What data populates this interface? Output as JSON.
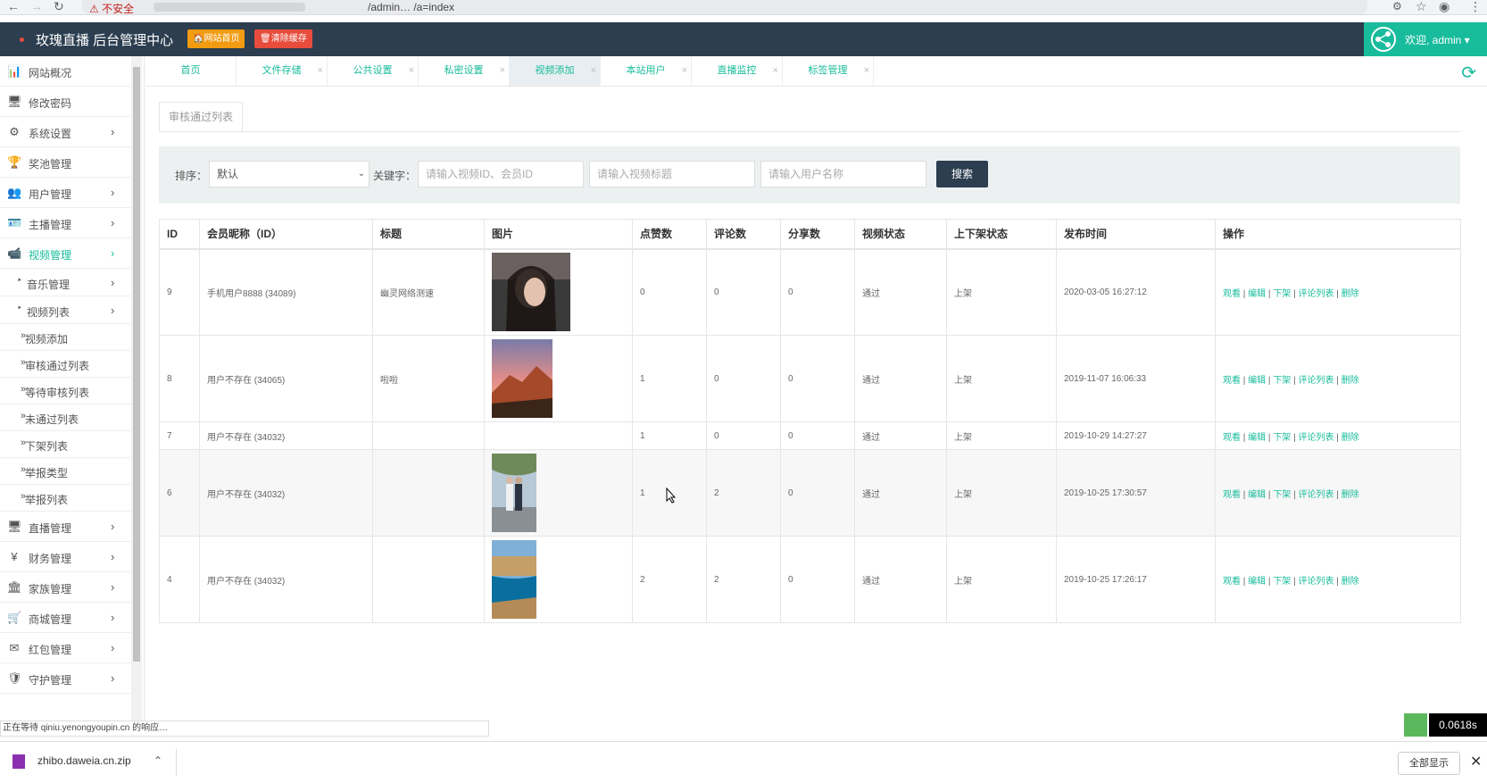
{
  "browser": {
    "insecure": "⚠ 不安全",
    "url": "/admin… /a=index"
  },
  "header": {
    "brand": "玫瑰直播 后台管理中心",
    "btn_home": "🏠网站首页",
    "btn_cache": "🗑清除缓存",
    "welcome": "欢迎, admin ▾",
    "colors": {
      "header_bg": "#2c3e50",
      "accent": "#18bc9c",
      "btn_home": "#f39c12",
      "btn_cache": "#e74c3c"
    }
  },
  "sidebar": {
    "items": [
      {
        "icon": "bar-chart-icon",
        "glyph": "📊",
        "label": "网站概况"
      },
      {
        "icon": "monitor-icon",
        "glyph": "🖥",
        "label": "修改密码"
      },
      {
        "icon": "gears-icon",
        "glyph": "⚙",
        "label": "系统设置",
        "chevron": "›"
      },
      {
        "icon": "trophy-icon",
        "glyph": "🏆",
        "label": "奖池管理"
      },
      {
        "icon": "users-icon",
        "glyph": "👥",
        "label": "用户管理",
        "chevron": "›"
      },
      {
        "icon": "id-badge-icon",
        "glyph": "🪪",
        "label": "主播管理",
        "chevron": "›"
      },
      {
        "icon": "video-camera-icon",
        "glyph": "📹",
        "label": "视频管理",
        "chevron": "›"
      },
      {
        "icon": "",
        "glyph": "‣",
        "label": "音乐管理",
        "chevron": "›"
      },
      {
        "icon": "",
        "glyph": "‣",
        "label": "视频列表",
        "chevron": "›"
      },
      {
        "icon": "",
        "glyph": "»",
        "label": "视频添加"
      },
      {
        "icon": "",
        "glyph": "»",
        "label": "审核通过列表"
      },
      {
        "icon": "",
        "glyph": "»",
        "label": "等待审核列表"
      },
      {
        "icon": "",
        "glyph": "»",
        "label": "未通过列表"
      },
      {
        "icon": "",
        "glyph": "»",
        "label": "下架列表"
      },
      {
        "icon": "",
        "glyph": "»",
        "label": "举报类型"
      },
      {
        "icon": "",
        "glyph": "»",
        "label": "举报列表"
      },
      {
        "icon": "desktop-icon",
        "glyph": "🖥",
        "label": "直播管理",
        "chevron": "›"
      },
      {
        "icon": "yen-icon",
        "glyph": "¥",
        "label": "财务管理",
        "chevron": "›"
      },
      {
        "icon": "institution-icon",
        "glyph": "🏛",
        "label": "家族管理",
        "chevron": "›"
      },
      {
        "icon": "cart-icon",
        "glyph": "🛒",
        "label": "商城管理",
        "chevron": "›"
      },
      {
        "icon": "envelope-icon",
        "glyph": "✉",
        "label": "红包管理",
        "chevron": "›"
      },
      {
        "icon": "shield-icon",
        "glyph": "🛡",
        "label": "守护管理",
        "chevron": "›"
      }
    ]
  },
  "tabs": [
    {
      "label": "首页"
    },
    {
      "label": "文件存储"
    },
    {
      "label": "公共设置"
    },
    {
      "label": "私密设置"
    },
    {
      "label": "视频添加"
    },
    {
      "label": "本站用户"
    },
    {
      "label": "直播监控"
    },
    {
      "label": "标签管理"
    }
  ],
  "content": {
    "subtab": "审核通过列表",
    "search": {
      "sort_label": "排序：",
      "sort_value": "默认",
      "keyword_label": "关键字：",
      "ph_id": "请输入视频ID、会员ID",
      "ph_title": "请输入视频标题",
      "ph_user": "请输入用户名称",
      "button": "搜索"
    },
    "table": {
      "headers": [
        "ID",
        "会员昵称（ID）",
        "标题",
        "图片",
        "点赞数",
        "评论数",
        "分享数",
        "视频状态",
        "上下架状态",
        "发布时间",
        "操作"
      ],
      "ops": [
        "观看",
        "编辑",
        "下架",
        "评论列表",
        "删除"
      ],
      "rows": [
        {
          "id": "9",
          "member": "手机用户8888 (34089)",
          "title": "幽灵网络测速",
          "image": "portrait-dark",
          "likes": "0",
          "comments": "0",
          "shares": "0",
          "status": "通过",
          "shelf": "上架",
          "time": "2020-03-05 16:27:12"
        },
        {
          "id": "8",
          "member": "用户不存在 (34065)",
          "title": "啦啦",
          "image": "mountain-sunset",
          "likes": "1",
          "comments": "0",
          "shares": "0",
          "status": "通过",
          "shelf": "上架",
          "time": "2019-11-07 16:06:33"
        },
        {
          "id": "7",
          "member": "用户不存在 (34032)",
          "title": "",
          "image": "",
          "likes": "1",
          "comments": "0",
          "shares": "0",
          "status": "通过",
          "shelf": "上架",
          "time": "2019-10-29 14:27:27"
        },
        {
          "id": "6",
          "member": "用户不存在 (34032)",
          "title": "",
          "image": "wedding-couple",
          "likes": "1",
          "comments": "2",
          "shares": "0",
          "status": "通过",
          "shelf": "上架",
          "time": "2019-10-25 17:30:57"
        },
        {
          "id": "4",
          "member": "用户不存在 (34032)",
          "title": "",
          "image": "coastal-cliffs",
          "likes": "2",
          "comments": "2",
          "shares": "0",
          "status": "通过",
          "shelf": "上架",
          "time": "2019-10-25 17:26:17"
        }
      ]
    }
  },
  "statusbar": "正在等待 qiniu.yenongyoupin.cn 的响应…",
  "timer": "0.0618s",
  "download": {
    "file": "zhibo.daweia.cn.zip",
    "show_all": "全部显示"
  }
}
